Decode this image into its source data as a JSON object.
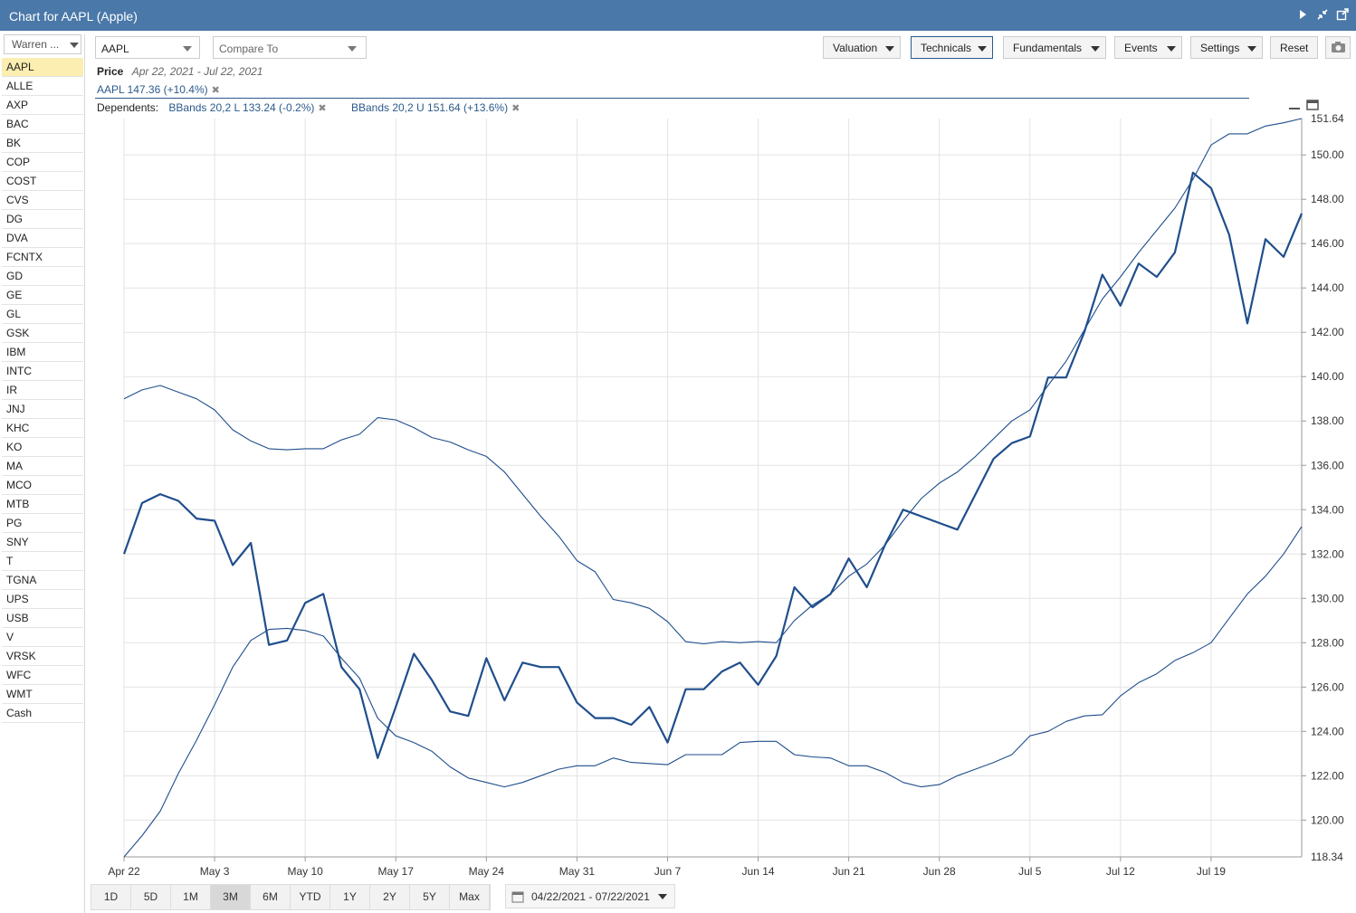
{
  "window": {
    "title": "Chart for AAPL (Apple)"
  },
  "sidebar": {
    "dropdown": "Warren ...",
    "items": [
      "AAPL",
      "ALLE",
      "AXP",
      "BAC",
      "BK",
      "COP",
      "COST",
      "CVS",
      "DG",
      "DVA",
      "FCNTX",
      "GD",
      "GE",
      "GL",
      "GSK",
      "IBM",
      "INTC",
      "IR",
      "JNJ",
      "KHC",
      "KO",
      "MA",
      "MCO",
      "MTB",
      "PG",
      "SNY",
      "T",
      "TGNA",
      "UPS",
      "USB",
      "V",
      "VRSK",
      "WFC",
      "WMT",
      "Cash"
    ],
    "selected": "AAPL"
  },
  "toolbar": {
    "symbol": "AAPL",
    "compare_placeholder": "Compare To",
    "buttons": [
      "Valuation",
      "Technicals",
      "Fundamentals",
      "Events",
      "Settings"
    ],
    "active_button": "Technicals",
    "reset": "Reset"
  },
  "info": {
    "price_label": "Price",
    "date_range": "Apr 22, 2021 - Jul 22, 2021",
    "series_label": "AAPL 147.36 (+10.4%)",
    "dependents_label": "Dependents:",
    "dependents": [
      "BBands 20,2 L 133.24 (-0.2%)",
      "BBands 20,2 U 151.64 (+13.6%)"
    ]
  },
  "range": {
    "buttons": [
      "1D",
      "5D",
      "1M",
      "3M",
      "6M",
      "YTD",
      "1Y",
      "2Y",
      "5Y",
      "Max"
    ],
    "active": "3M",
    "date_box": "04/22/2021 - 07/22/2021"
  },
  "chart_data": {
    "type": "line",
    "x_tick_labels": [
      "Apr 22",
      "May 3",
      "May 10",
      "May 17",
      "May 24",
      "May 31",
      "Jun 7",
      "Jun 14",
      "Jun 21",
      "Jun 28",
      "Jul 5",
      "Jul 12",
      "Jul 19"
    ],
    "x_tick_index": [
      0,
      5,
      10,
      15,
      20,
      25,
      30,
      35,
      40,
      45,
      50,
      55,
      60
    ],
    "y_tick_labels": [
      "120.00",
      "122.00",
      "124.00",
      "126.00",
      "128.00",
      "130.00",
      "132.00",
      "134.00",
      "136.00",
      "138.00",
      "140.00",
      "142.00",
      "144.00",
      "146.00",
      "148.00",
      "150.00"
    ],
    "y_min_label": "118.34",
    "y_max_label": "151.64",
    "ylim": [
      118.34,
      151.64
    ],
    "x_count": 65,
    "grid": true,
    "series": [
      {
        "role": "price",
        "color": "#1f4e8c",
        "values": [
          132.0,
          134.3,
          134.7,
          134.4,
          133.6,
          133.5,
          131.5,
          132.5,
          127.9,
          128.1,
          129.8,
          130.2,
          126.9,
          125.9,
          122.8,
          125.1,
          127.5,
          126.3,
          124.9,
          124.7,
          127.3,
          125.4,
          127.1,
          126.9,
          126.9,
          125.3,
          124.6,
          124.6,
          124.3,
          125.1,
          123.5,
          125.9,
          125.9,
          126.7,
          127.1,
          126.1,
          127.4,
          130.5,
          129.6,
          130.2,
          131.8,
          130.5,
          132.4,
          134.0,
          133.7,
          133.4,
          133.1,
          134.7,
          136.3,
          137.0,
          137.3,
          139.96,
          139.96,
          142.0,
          144.6,
          143.2,
          145.1,
          144.5,
          145.6,
          149.2,
          148.5,
          146.4,
          142.4,
          146.2,
          145.4,
          147.36
        ]
      },
      {
        "role": "upper",
        "color": "#1f4e8c",
        "values": [
          139.0,
          139.4,
          139.6,
          139.3,
          139.0,
          138.5,
          137.6,
          137.1,
          136.75,
          136.7,
          136.75,
          136.75,
          137.15,
          137.4,
          138.15,
          138.05,
          137.7,
          137.25,
          137.05,
          136.7,
          136.4,
          135.7,
          134.7,
          133.7,
          132.8,
          131.7,
          131.2,
          129.95,
          129.8,
          129.55,
          128.95,
          128.05,
          127.95,
          128.05,
          128.0,
          128.05,
          128.0,
          129.0,
          129.7,
          130.2,
          131.0,
          131.55,
          132.4,
          133.5,
          134.5,
          135.2,
          135.7,
          136.4,
          137.2,
          138.0,
          138.5,
          139.6,
          140.7,
          142.1,
          143.5,
          144.5,
          145.6,
          146.6,
          147.6,
          148.9,
          150.45,
          150.95,
          150.95,
          151.3,
          151.45,
          151.64
        ]
      },
      {
        "role": "lower",
        "color": "#1f4e8c",
        "values": [
          118.34,
          119.3,
          120.4,
          122.1,
          123.6,
          125.2,
          126.9,
          128.1,
          128.6,
          128.65,
          128.55,
          128.3,
          127.3,
          126.4,
          124.6,
          123.8,
          123.5,
          123.1,
          122.4,
          121.9,
          121.7,
          121.5,
          121.7,
          122.0,
          122.3,
          122.45,
          122.45,
          122.8,
          122.6,
          122.55,
          122.5,
          122.95,
          122.95,
          122.95,
          123.5,
          123.55,
          123.55,
          122.95,
          122.85,
          122.8,
          122.45,
          122.45,
          122.15,
          121.7,
          121.5,
          121.6,
          122.0,
          122.3,
          122.6,
          122.95,
          123.8,
          124.0,
          124.45,
          124.7,
          124.75,
          125.6,
          126.2,
          126.6,
          127.2,
          127.55,
          128.0,
          129.1,
          130.2,
          131.0,
          132.0,
          133.24
        ]
      }
    ]
  }
}
